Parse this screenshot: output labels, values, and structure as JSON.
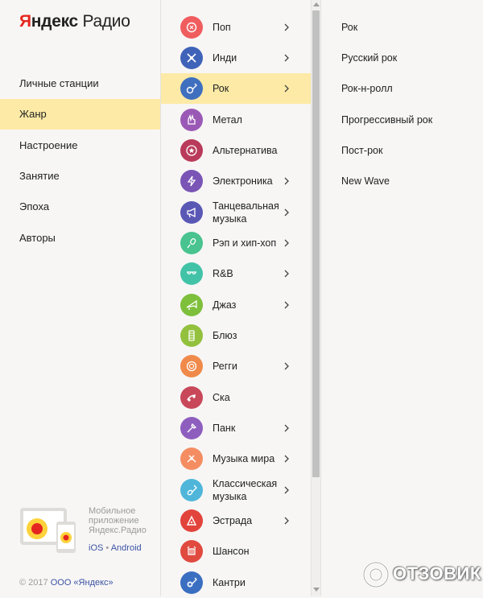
{
  "logo": {
    "ya_first": "Я",
    "ya_rest": "ндекс",
    "radio": "Радио"
  },
  "nav": [
    {
      "label": "Личные станции",
      "active": false
    },
    {
      "label": "Жанр",
      "active": true
    },
    {
      "label": "Настроение",
      "active": false
    },
    {
      "label": "Занятие",
      "active": false
    },
    {
      "label": "Эпоха",
      "active": false
    },
    {
      "label": "Авторы",
      "active": false
    }
  ],
  "promo": {
    "line1": "Мобильное",
    "line2": "приложение",
    "line3": "Яндекс.Радио",
    "ios": "iOS",
    "sep": "•",
    "android": "Android"
  },
  "copyright": {
    "prefix": "© 2017",
    "company": "ООО «Яндекс»"
  },
  "genres": [
    {
      "label": "Поп",
      "color": "#f05d5e",
      "icon": "pop-icon",
      "has_sub": true
    },
    {
      "label": "Инди",
      "color": "#3f63b8",
      "icon": "indie-icon",
      "has_sub": true
    },
    {
      "label": "Рок",
      "color": "#3f6fbf",
      "icon": "guitar-icon",
      "has_sub": true,
      "active": true
    },
    {
      "label": "Метал",
      "color": "#9b59b6",
      "icon": "metal-icon",
      "has_sub": false
    },
    {
      "label": "Альтернатива",
      "color": "#b93a5a",
      "icon": "star-icon",
      "has_sub": false
    },
    {
      "label": "Электроника",
      "color": "#7a55b5",
      "icon": "lightning-icon",
      "has_sub": true
    },
    {
      "label": "Танцевальная музыка",
      "color": "#5a58b5",
      "icon": "megaphone-icon",
      "has_sub": true
    },
    {
      "label": "Рэп и хип-хоп",
      "color": "#49c38f",
      "icon": "microphone-icon",
      "has_sub": true
    },
    {
      "label": "R&B",
      "color": "#42c3a8",
      "icon": "glasses-icon",
      "has_sub": true
    },
    {
      "label": "Джаз",
      "color": "#7ebf3c",
      "icon": "trumpet-icon",
      "has_sub": true
    },
    {
      "label": "Блюз",
      "color": "#93c13e",
      "icon": "harmonica-icon",
      "has_sub": false
    },
    {
      "label": "Регги",
      "color": "#f08a4b",
      "icon": "lion-icon",
      "has_sub": true
    },
    {
      "label": "Ска",
      "color": "#c8485a",
      "icon": "ska-icon",
      "has_sub": false
    },
    {
      "label": "Панк",
      "color": "#8e5ebf",
      "icon": "pin-icon",
      "has_sub": true
    },
    {
      "label": "Музыка мира",
      "color": "#f58d62",
      "icon": "world-icon",
      "has_sub": true
    },
    {
      "label": "Классическая музыка",
      "color": "#4fb6d9",
      "icon": "violin-icon",
      "has_sub": true
    },
    {
      "label": "Эстрада",
      "color": "#e2433b",
      "icon": "triangle-icon",
      "has_sub": true
    },
    {
      "label": "Шансон",
      "color": "#e04a3f",
      "icon": "accordion-icon",
      "has_sub": false
    },
    {
      "label": "Кантри",
      "color": "#3a6ec1",
      "icon": "banjo-icon",
      "has_sub": false
    }
  ],
  "subgenres": [
    {
      "label": "Рок"
    },
    {
      "label": "Русский рок"
    },
    {
      "label": "Рок-н-ролл"
    },
    {
      "label": "Прогрессивный рок"
    },
    {
      "label": "Пост-рок"
    },
    {
      "label": "New Wave"
    }
  ],
  "watermark": {
    "text": "ОТЗОВИК"
  }
}
